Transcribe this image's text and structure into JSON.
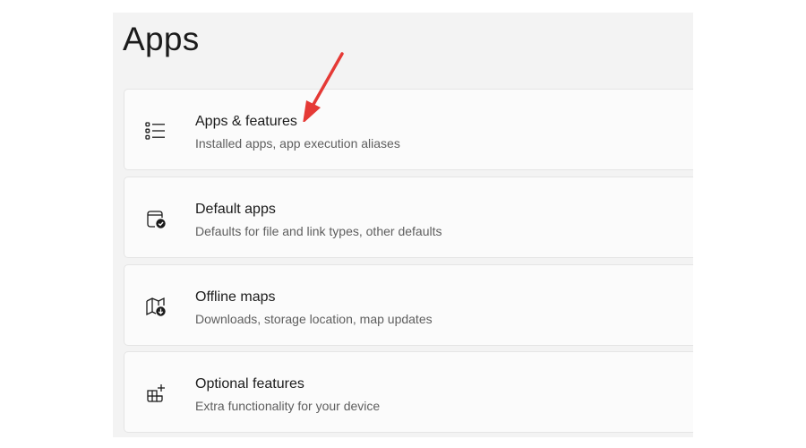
{
  "page": {
    "title": "Apps"
  },
  "items": [
    {
      "title": "Apps & features",
      "subtitle": "Installed apps, app execution aliases",
      "icon": "apps-list-icon"
    },
    {
      "title": "Default apps",
      "subtitle": "Defaults for file and link types, other defaults",
      "icon": "default-apps-icon"
    },
    {
      "title": "Offline maps",
      "subtitle": "Downloads, storage location, map updates",
      "icon": "offline-maps-icon"
    },
    {
      "title": "Optional features",
      "subtitle": "Extra functionality for your device",
      "icon": "optional-features-icon"
    }
  ],
  "annotation": {
    "arrow_color": "#e53935",
    "arrow_target": "Apps & features"
  }
}
